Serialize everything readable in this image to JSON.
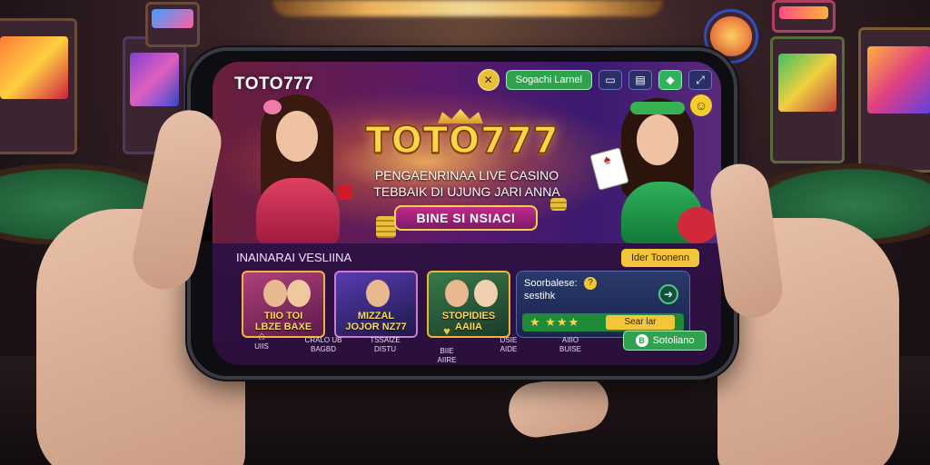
{
  "header": {
    "brand": "TOTO777",
    "search_label": "Sogachi Larnel",
    "icons": [
      "close-icon",
      "chat-icon",
      "document-icon",
      "box-icon",
      "expand-icon",
      "smile-icon"
    ]
  },
  "hero": {
    "logo": "TOTO777",
    "subtitle_line1": "PENGAENRINAA LIVE CASINO",
    "subtitle_line2": "TEBBAIK DI UJUNG JARI ANNA",
    "cta_label": "BINE SI NSIACI"
  },
  "section": {
    "title": "INAINARAI VESLIINA",
    "tag_label": "Ider Toonenn"
  },
  "games": [
    {
      "title": "TIIO TOI\nLBZE BAXE"
    },
    {
      "title": "MIZZAL\nJOJOR NZ77"
    },
    {
      "title": "STOPIDIES\nAAIIA"
    }
  ],
  "promo": {
    "title_line1": "Soorbalese:",
    "title_line2": "sestihk",
    "question": "?",
    "stars": "★ ★★★",
    "action_label": "Sear lar"
  },
  "nav": {
    "items": [
      {
        "icon": "⌂",
        "label": "UIIS"
      },
      {
        "icon": "",
        "label": "CRALO UB\nBAGBD"
      },
      {
        "icon": "",
        "label": "TSSAIZE\nDISTU"
      },
      {
        "icon": "♥",
        "label": "BIIE\nAIIRE"
      },
      {
        "icon": "",
        "label": "DSIE\nAIDE"
      },
      {
        "icon": "",
        "label": "AIIIO\nBUISE"
      }
    ],
    "cta_label": "Sotoliano",
    "cta_badge": "B"
  },
  "colors": {
    "accent_gold": "#f3c63a",
    "accent_green": "#2fa24e",
    "screen_bg": "#2a0f3c"
  }
}
